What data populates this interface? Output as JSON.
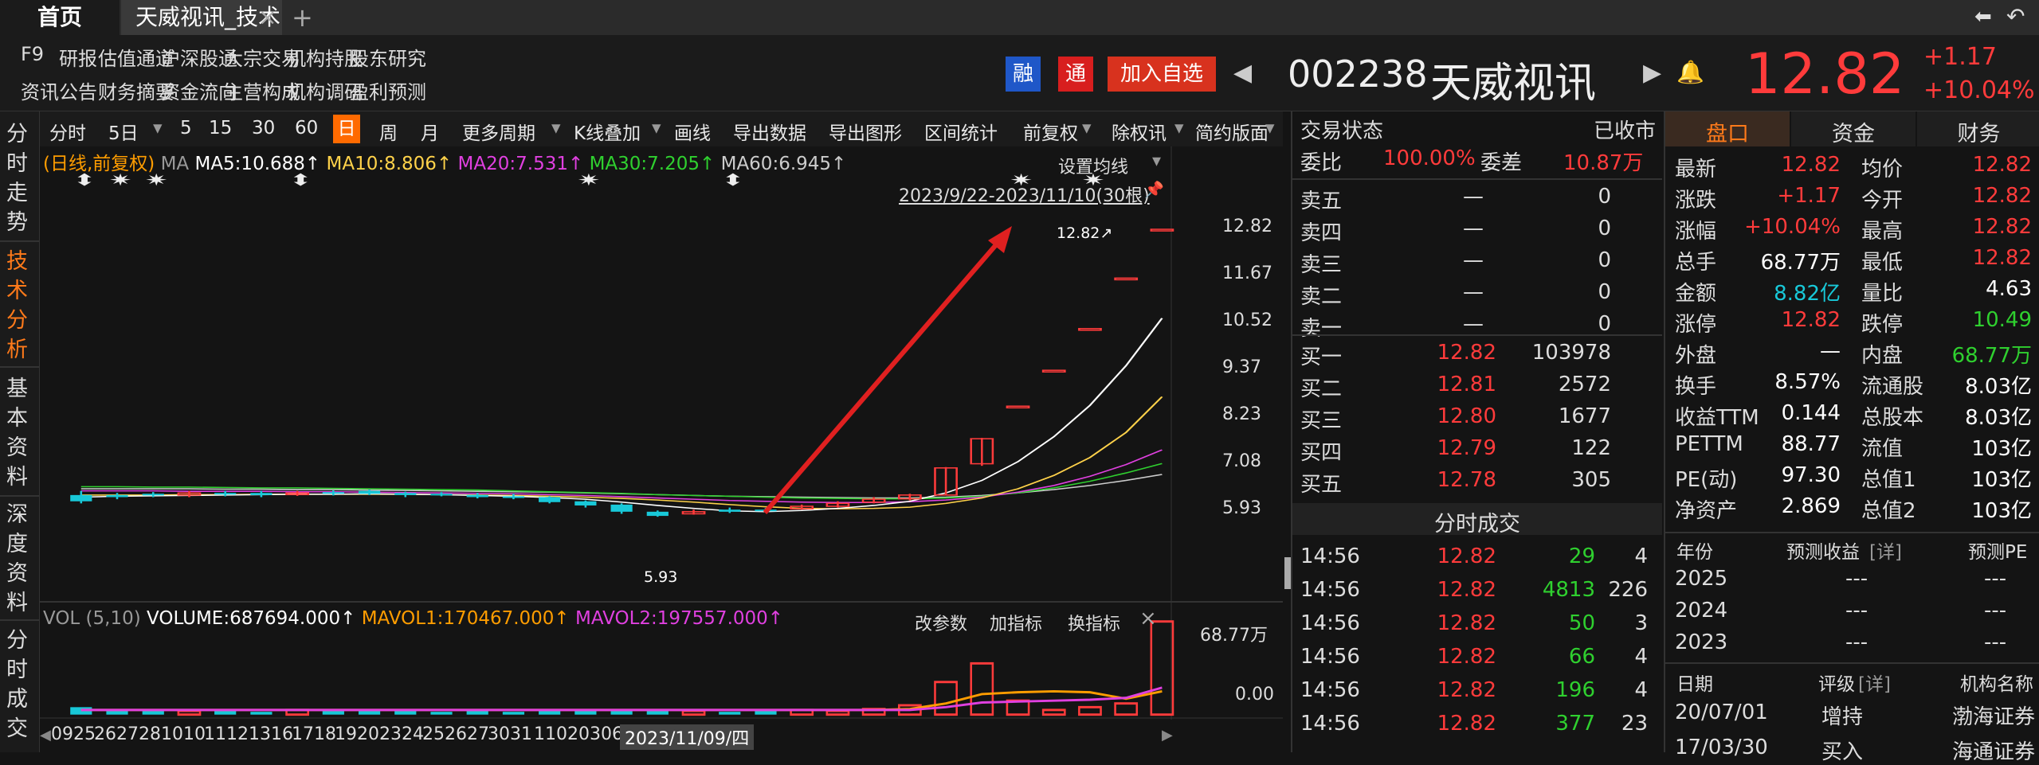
{
  "tabs": {
    "home": "首页",
    "active": "天威视讯_技术分析",
    "close": "×",
    "add": "+"
  },
  "window_icons": {
    "back": "back-arrow-icon",
    "undo": "undo-icon"
  },
  "menu": {
    "row1": [
      "F9",
      "研报",
      "估值通道",
      "沪深股通",
      "大宗交易",
      "机构持股",
      "股东研究"
    ],
    "row2": [
      "资讯",
      "公告",
      "财务摘要",
      "资金流向",
      "主营构成",
      "机构调研",
      "盈利预测"
    ]
  },
  "stock_header": {
    "badge_rong": "融",
    "badge_tong": "通",
    "add_watch": "加入自选",
    "code": "002238",
    "name": "天威视讯",
    "price": "12.82",
    "change": "+1.17",
    "change_pct": "+10.04%"
  },
  "leftnav": [
    {
      "label": "分时走势"
    },
    {
      "label": "技术分析"
    },
    {
      "label": "基本资料"
    },
    {
      "label": "深度资料"
    },
    {
      "label": "分时成交"
    }
  ],
  "toolbar": {
    "items": [
      "分时",
      "5日",
      "5",
      "15",
      "30",
      "60",
      "日",
      "周",
      "月",
      "更多周期",
      "K线叠加",
      "画线",
      "导出数据",
      "导出图形",
      "区间统计",
      "前复权",
      "除权讯",
      "简约版面"
    ],
    "active": "日"
  },
  "ma_legend": {
    "prefix": "(日线,前复权)",
    "ma": "MA",
    "ma5": "MA5:10.688↑",
    "ma10": "MA10:8.806↑",
    "ma20": "MA20:7.531↑",
    "ma30": "MA30:7.205↑",
    "ma60": "MA60:6.945↑",
    "settings": "设置均线",
    "range": "2023/9/22-2023/11/10(30根)"
  },
  "vol_legend": {
    "label": "VOL (5,10)",
    "volume": "VOLUME:687694.000↑",
    "mavol1": "MAVOL1:170467.000↑",
    "mavol2": "MAVOL2:197557.000↑",
    "edit": "改参数",
    "add": "加指标",
    "switch": "换指标",
    "close": "×"
  },
  "chart_data": {
    "type": "candlestick",
    "price_axis": [
      "12.82",
      "11.67",
      "10.52",
      "9.37",
      "8.23",
      "7.08",
      "5.93"
    ],
    "volume_axis": [
      "68.77万",
      "0.00"
    ],
    "x_labels": [
      "09",
      "25",
      "26",
      "27",
      "28",
      "10",
      "10",
      "11",
      "12",
      "13",
      "16",
      "17",
      "18",
      "19",
      "20",
      "23",
      "24",
      "25",
      "26",
      "27",
      "30",
      "31",
      "11",
      "02",
      "03",
      "06",
      "2023/11/09/四"
    ],
    "annotations": {
      "high": "12.82↗",
      "low": "5.93"
    },
    "candles": [
      {
        "o": 6.45,
        "c": 6.3,
        "h": 6.55,
        "l": 6.25
      },
      {
        "o": 6.45,
        "c": 6.4,
        "h": 6.5,
        "l": 6.35
      },
      {
        "o": 6.48,
        "c": 6.45,
        "h": 6.52,
        "l": 6.4
      },
      {
        "o": 6.45,
        "c": 6.5,
        "h": 6.55,
        "l": 6.4
      },
      {
        "o": 6.5,
        "c": 6.48,
        "h": 6.55,
        "l": 6.42
      },
      {
        "o": 6.5,
        "c": 6.45,
        "h": 6.55,
        "l": 6.4
      },
      {
        "o": 6.48,
        "c": 6.5,
        "h": 6.55,
        "l": 6.43
      },
      {
        "o": 6.52,
        "c": 6.48,
        "h": 6.56,
        "l": 6.44
      },
      {
        "o": 6.55,
        "c": 6.48,
        "h": 6.58,
        "l": 6.45
      },
      {
        "o": 6.5,
        "c": 6.45,
        "h": 6.53,
        "l": 6.4
      },
      {
        "o": 6.48,
        "c": 6.45,
        "h": 6.52,
        "l": 6.42
      },
      {
        "o": 6.45,
        "c": 6.4,
        "h": 6.5,
        "l": 6.37
      },
      {
        "o": 6.42,
        "c": 6.38,
        "h": 6.48,
        "l": 6.35
      },
      {
        "o": 6.4,
        "c": 6.28,
        "h": 6.42,
        "l": 6.25
      },
      {
        "o": 6.3,
        "c": 6.2,
        "h": 6.32,
        "l": 6.15
      },
      {
        "o": 6.22,
        "c": 6.05,
        "h": 6.25,
        "l": 6.0
      },
      {
        "o": 6.05,
        "c": 5.95,
        "h": 6.08,
        "l": 5.93
      },
      {
        "o": 6.0,
        "c": 6.05,
        "h": 6.1,
        "l": 5.98
      },
      {
        "o": 6.1,
        "c": 6.05,
        "h": 6.15,
        "l": 6.02
      },
      {
        "o": 6.1,
        "c": 6.08,
        "h": 6.14,
        "l": 6.05
      },
      {
        "o": 6.12,
        "c": 6.18,
        "h": 6.22,
        "l": 6.1
      },
      {
        "o": 6.18,
        "c": 6.25,
        "h": 6.3,
        "l": 6.15
      },
      {
        "o": 6.28,
        "c": 6.35,
        "h": 6.4,
        "l": 6.25
      },
      {
        "o": 6.36,
        "c": 6.45,
        "h": 6.48,
        "l": 6.32
      },
      {
        "o": 6.45,
        "c": 7.1,
        "h": 7.12,
        "l": 6.44
      },
      {
        "o": 7.2,
        "c": 7.8,
        "h": 7.82,
        "l": 7.15
      },
      {
        "o": 8.58,
        "c": 8.58,
        "h": 8.58,
        "l": 8.58
      },
      {
        "o": 9.44,
        "c": 9.44,
        "h": 9.44,
        "l": 9.44
      },
      {
        "o": 10.44,
        "c": 10.44,
        "h": 10.44,
        "l": 10.44
      },
      {
        "o": 11.65,
        "c": 11.65,
        "h": 11.65,
        "l": 11.65
      },
      {
        "o": 12.82,
        "c": 12.82,
        "h": 12.82,
        "l": 12.82
      }
    ],
    "volume": [
      0.08,
      0.04,
      0.05,
      0.04,
      0.05,
      0.03,
      0.05,
      0.04,
      0.05,
      0.04,
      0.03,
      0.04,
      0.03,
      0.05,
      0.04,
      0.06,
      0.06,
      0.04,
      0.03,
      0.04,
      0.05,
      0.04,
      0.06,
      0.1,
      0.35,
      0.55,
      0.15,
      0.05,
      0.08,
      0.12,
      1.0
    ],
    "ma": {
      "ma5": {
        "color": "#ffffff",
        "values": [
          6.4,
          6.42,
          6.43,
          6.44,
          6.45,
          6.46,
          6.47,
          6.47,
          6.48,
          6.47,
          6.46,
          6.44,
          6.42,
          6.39,
          6.35,
          6.28,
          6.2,
          6.13,
          6.07,
          6.05,
          6.08,
          6.13,
          6.2,
          6.3,
          6.5,
          6.8,
          7.25,
          7.85,
          8.6,
          9.55,
          10.688
        ]
      },
      "ma10": {
        "color": "#ffd24a",
        "values": [
          6.45,
          6.45,
          6.45,
          6.46,
          6.46,
          6.47,
          6.47,
          6.47,
          6.47,
          6.47,
          6.46,
          6.45,
          6.44,
          6.42,
          6.4,
          6.37,
          6.33,
          6.28,
          6.22,
          6.17,
          6.13,
          6.12,
          6.13,
          6.16,
          6.25,
          6.38,
          6.6,
          6.92,
          7.35,
          7.95,
          8.806
        ]
      },
      "ma20": {
        "color": "#e040e0",
        "values": [
          6.55,
          6.55,
          6.55,
          6.54,
          6.54,
          6.54,
          6.53,
          6.53,
          6.52,
          6.51,
          6.5,
          6.49,
          6.48,
          6.46,
          6.44,
          6.41,
          6.38,
          6.35,
          6.32,
          6.3,
          6.28,
          6.27,
          6.27,
          6.29,
          6.33,
          6.4,
          6.52,
          6.68,
          6.9,
          7.18,
          7.531
        ]
      },
      "ma30": {
        "color": "#2fd02f",
        "values": [
          6.65,
          6.65,
          6.64,
          6.64,
          6.63,
          6.62,
          6.62,
          6.61,
          6.6,
          6.59,
          6.58,
          6.57,
          6.55,
          6.53,
          6.51,
          6.49,
          6.46,
          6.44,
          6.42,
          6.4,
          6.38,
          6.37,
          6.36,
          6.36,
          6.38,
          6.42,
          6.5,
          6.62,
          6.78,
          6.98,
          7.205
        ]
      },
      "ma60": {
        "color": "#cccccc",
        "values": [
          6.6,
          6.6,
          6.6,
          6.6,
          6.59,
          6.59,
          6.58,
          6.58,
          6.57,
          6.56,
          6.55,
          6.54,
          6.53,
          6.52,
          6.5,
          6.48,
          6.46,
          6.44,
          6.42,
          6.41,
          6.4,
          6.39,
          6.38,
          6.38,
          6.4,
          6.44,
          6.5,
          6.58,
          6.68,
          6.8,
          6.945
        ]
      }
    },
    "vol_ma": {
      "mavol1": {
        "color": "#ff9d00",
        "values": [
          0.05,
          0.05,
          0.05,
          0.05,
          0.05,
          0.05,
          0.05,
          0.05,
          0.05,
          0.05,
          0.05,
          0.05,
          0.05,
          0.05,
          0.05,
          0.05,
          0.05,
          0.05,
          0.05,
          0.05,
          0.05,
          0.05,
          0.05,
          0.06,
          0.12,
          0.22,
          0.24,
          0.25,
          0.24,
          0.17,
          0.25
        ]
      },
      "mavol2": {
        "color": "#e040e0",
        "values": [
          0.05,
          0.05,
          0.05,
          0.05,
          0.05,
          0.05,
          0.05,
          0.05,
          0.05,
          0.05,
          0.05,
          0.05,
          0.05,
          0.05,
          0.05,
          0.05,
          0.05,
          0.05,
          0.05,
          0.05,
          0.05,
          0.05,
          0.05,
          0.05,
          0.08,
          0.13,
          0.14,
          0.15,
          0.16,
          0.18,
          0.29
        ]
      }
    }
  },
  "orderbook": {
    "status_label": "交易状态",
    "status_value": "已收市",
    "weibi_label": "委比",
    "weibi_value": "100.00%",
    "weicha_label": "委差",
    "weicha_value": "10.87万",
    "sells": [
      {
        "label": "卖五",
        "price": "—",
        "vol": "0"
      },
      {
        "label": "卖四",
        "price": "—",
        "vol": "0"
      },
      {
        "label": "卖三",
        "price": "—",
        "vol": "0"
      },
      {
        "label": "卖二",
        "price": "—",
        "vol": "0"
      },
      {
        "label": "卖一",
        "price": "—",
        "vol": "0"
      }
    ],
    "buys": [
      {
        "label": "买一",
        "price": "12.82",
        "vol": "103978"
      },
      {
        "label": "买二",
        "price": "12.81",
        "vol": "2572"
      },
      {
        "label": "买三",
        "price": "12.80",
        "vol": "1677"
      },
      {
        "label": "买四",
        "price": "12.79",
        "vol": "122"
      },
      {
        "label": "买五",
        "price": "12.78",
        "vol": "305"
      }
    ],
    "ticks_title": "分时成交",
    "ticks": [
      {
        "time": "14:56",
        "price": "12.82",
        "vol": "29",
        "n": "4"
      },
      {
        "time": "14:56",
        "price": "12.82",
        "vol": "4813",
        "n": "226"
      },
      {
        "time": "14:56",
        "price": "12.82",
        "vol": "50",
        "n": "3"
      },
      {
        "time": "14:56",
        "price": "12.82",
        "vol": "66",
        "n": "4"
      },
      {
        "time": "14:56",
        "price": "12.82",
        "vol": "196",
        "n": "4"
      },
      {
        "time": "14:56",
        "price": "12.82",
        "vol": "377",
        "n": "23"
      }
    ]
  },
  "quote_tabs": [
    "盘口",
    "资金",
    "财务"
  ],
  "quote": [
    {
      "l1": "最新",
      "v1": "12.82",
      "c1": "red",
      "l2": "均价",
      "v2": "12.82",
      "c2": "red"
    },
    {
      "l1": "涨跌",
      "v1": "+1.17",
      "c1": "red",
      "l2": "今开",
      "v2": "12.82",
      "c2": "red"
    },
    {
      "l1": "涨幅",
      "v1": "+10.04%",
      "c1": "red",
      "l2": "最高",
      "v2": "12.82",
      "c2": "red"
    },
    {
      "l1": "总手",
      "v1": "68.77万",
      "c1": "white",
      "l2": "最低",
      "v2": "12.82",
      "c2": "red"
    },
    {
      "l1": "金额",
      "v1": "8.82亿",
      "c1": "cyan",
      "l2": "量比",
      "v2": "4.63",
      "c2": "white"
    },
    {
      "l1": "涨停",
      "v1": "12.82",
      "c1": "red",
      "l2": "跌停",
      "v2": "10.49",
      "c2": "green"
    },
    {
      "l1": "外盘",
      "v1": "—",
      "c1": "white",
      "l2": "内盘",
      "v2": "68.77万",
      "c2": "green"
    },
    {
      "l1": "换手",
      "v1": "8.57%",
      "c1": "white",
      "l2": "流通股",
      "v2": "8.03亿",
      "c2": "white"
    },
    {
      "l1": "收益TTM",
      "v1": "0.144",
      "c1": "white",
      "l2": "总股本",
      "v2": "8.03亿",
      "c2": "white"
    },
    {
      "l1": "PETTM",
      "v1": "88.77",
      "c1": "white",
      "l2": "流值",
      "v2": "103亿",
      "c2": "white"
    },
    {
      "l1": "PE(动)",
      "v1": "97.30",
      "c1": "white",
      "l2": "总值1",
      "v2": "103亿",
      "c2": "white"
    },
    {
      "l1": "净资产",
      "v1": "2.869",
      "c1": "white",
      "l2": "总值2",
      "v2": "103亿",
      "c2": "white"
    }
  ],
  "forecast": {
    "h_year": "年份",
    "h_eps": "预测收益",
    "h_detail": "[详]",
    "h_pe": "预测PE",
    "rows": [
      {
        "year": "2025",
        "eps": "---",
        "pe": "---"
      },
      {
        "year": "2024",
        "eps": "---",
        "pe": "---"
      },
      {
        "year": "2023",
        "eps": "---",
        "pe": "---"
      }
    ]
  },
  "rating": {
    "h_date": "日期",
    "h_rating": "评级",
    "h_detail": "[详]",
    "h_org": "机构名称",
    "rows": [
      {
        "date": "20/07/01",
        "rating": "增持",
        "org": "渤海证券"
      },
      {
        "date": "17/03/30",
        "rating": "买入",
        "org": "海通证券"
      }
    ]
  },
  "colors": {
    "up": "#ff3b3b",
    "down": "#18c8d8",
    "accent": "#ff6a00",
    "bg": "#141414"
  }
}
